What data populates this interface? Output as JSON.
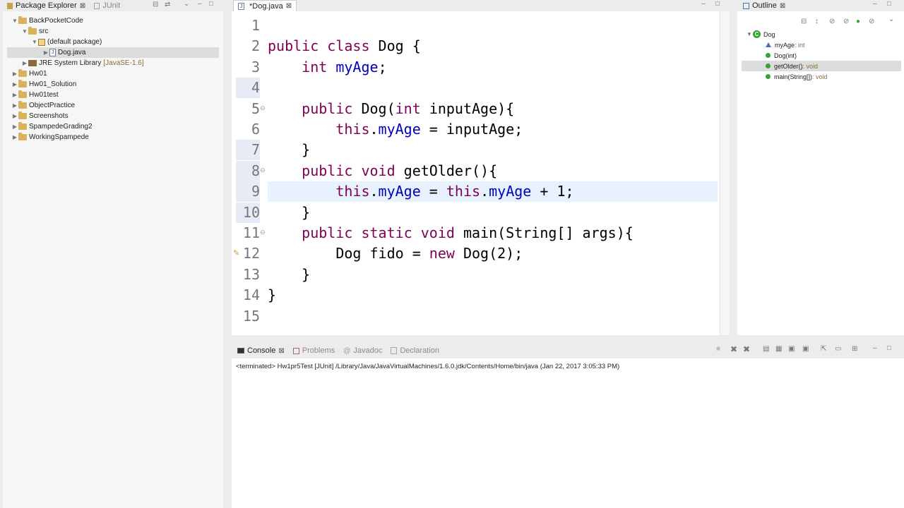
{
  "package_explorer": {
    "tabs": [
      {
        "label": "Package Explorer",
        "active": true
      },
      {
        "label": "JUnit",
        "active": false
      }
    ],
    "tree": [
      {
        "label": "BackPocketCode",
        "depth": 0,
        "expanded": true,
        "kind": "project"
      },
      {
        "label": "src",
        "depth": 1,
        "expanded": true,
        "kind": "folder"
      },
      {
        "label": "(default package)",
        "depth": 2,
        "expanded": true,
        "kind": "package"
      },
      {
        "label": "Dog.java",
        "depth": 3,
        "expanded": false,
        "kind": "file",
        "selected": true
      },
      {
        "label": "JRE System Library",
        "suffix": "[JavaSE-1.6]",
        "depth": 1,
        "expanded": false,
        "kind": "library"
      },
      {
        "label": "Hw01",
        "depth": 0,
        "expanded": false,
        "kind": "project"
      },
      {
        "label": "Hw01_Solution",
        "depth": 0,
        "expanded": false,
        "kind": "project"
      },
      {
        "label": "Hw01test",
        "depth": 0,
        "expanded": false,
        "kind": "project"
      },
      {
        "label": "ObjectPractice",
        "depth": 0,
        "expanded": false,
        "kind": "project"
      },
      {
        "label": "Screenshots",
        "depth": 0,
        "expanded": false,
        "kind": "project"
      },
      {
        "label": "SpampedeGrading2",
        "depth": 0,
        "expanded": false,
        "kind": "project"
      },
      {
        "label": "WorkingSpampede",
        "depth": 0,
        "expanded": false,
        "kind": "project"
      }
    ]
  },
  "editor": {
    "tab_label": "*Dog.java",
    "current_line": 9,
    "lines": [
      {
        "n": "1",
        "code": []
      },
      {
        "n": "2",
        "code": [
          {
            "t": "public class ",
            "k": "kw"
          },
          {
            "t": "Dog {",
            "k": ""
          }
        ]
      },
      {
        "n": "3",
        "code": [
          {
            "t": "    ",
            "k": ""
          },
          {
            "t": "int ",
            "k": "kw"
          },
          {
            "t": "myAge",
            "k": "fld"
          },
          {
            "t": ";",
            "k": ""
          }
        ]
      },
      {
        "n": "4",
        "code": []
      },
      {
        "n": "5",
        "code": [
          {
            "t": "    ",
            "k": ""
          },
          {
            "t": "public ",
            "k": "kw"
          },
          {
            "t": "Dog(",
            "k": ""
          },
          {
            "t": "int ",
            "k": "kw"
          },
          {
            "t": "inputAge){",
            "k": ""
          }
        ]
      },
      {
        "n": "6",
        "code": [
          {
            "t": "        ",
            "k": ""
          },
          {
            "t": "this",
            "k": "kw"
          },
          {
            "t": ".",
            "k": ""
          },
          {
            "t": "myAge",
            "k": "fld"
          },
          {
            "t": " = inputAge;",
            "k": ""
          }
        ]
      },
      {
        "n": "7",
        "code": [
          {
            "t": "    }",
            "k": ""
          }
        ]
      },
      {
        "n": "8",
        "code": [
          {
            "t": "    ",
            "k": ""
          },
          {
            "t": "public void ",
            "k": "kw"
          },
          {
            "t": "getOlder(){",
            "k": ""
          }
        ]
      },
      {
        "n": "9",
        "code": [
          {
            "t": "        ",
            "k": ""
          },
          {
            "t": "this",
            "k": "kw"
          },
          {
            "t": ".",
            "k": ""
          },
          {
            "t": "myAge",
            "k": "fld"
          },
          {
            "t": " = ",
            "k": ""
          },
          {
            "t": "this",
            "k": "kw"
          },
          {
            "t": ".",
            "k": ""
          },
          {
            "t": "myAge",
            "k": "fld"
          },
          {
            "t": " + 1;",
            "k": ""
          }
        ]
      },
      {
        "n": "10",
        "code": [
          {
            "t": "    }",
            "k": ""
          }
        ]
      },
      {
        "n": "11",
        "code": [
          {
            "t": "    ",
            "k": ""
          },
          {
            "t": "public static void ",
            "k": "kw"
          },
          {
            "t": "main(String[] args){",
            "k": ""
          }
        ]
      },
      {
        "n": "12",
        "code": [
          {
            "t": "        Dog fido = ",
            "k": ""
          },
          {
            "t": "new ",
            "k": "kw"
          },
          {
            "t": "Dog(2);",
            "k": ""
          }
        ]
      },
      {
        "n": "13",
        "code": [
          {
            "t": "    }",
            "k": ""
          }
        ]
      },
      {
        "n": "14",
        "code": [
          {
            "t": "}",
            "k": ""
          }
        ]
      },
      {
        "n": "15",
        "code": []
      }
    ]
  },
  "outline": {
    "tab_label": "Outline",
    "items": [
      {
        "label": "Dog",
        "extra": "",
        "kind": "class",
        "depth": 0
      },
      {
        "label": "myAge",
        "extra": " : int",
        "kind": "field",
        "depth": 1
      },
      {
        "label": "Dog(int)",
        "extra": "",
        "kind": "constructor",
        "depth": 1
      },
      {
        "label": "getOlder()",
        "extra": " : void",
        "kind": "method",
        "depth": 1,
        "selected": true
      },
      {
        "label": "main(String[])",
        "extra": " : void",
        "kind": "static-method",
        "depth": 1
      }
    ]
  },
  "console": {
    "tabs": [
      {
        "label": "Console",
        "active": true
      },
      {
        "label": "Problems",
        "active": false
      },
      {
        "label": "Javadoc",
        "active": false
      },
      {
        "label": "Declaration",
        "active": false
      }
    ],
    "status_text": "<terminated> Hw1pr5Test [JUnit] /Library/Java/JavaVirtualMachines/1.6.0.jdk/Contents/Home/bin/java (Jan 22, 2017 3:05:33 PM)"
  },
  "colors": {
    "keyword": "#7f0055",
    "field": "#0000c0",
    "current_line_bg": "#e8f2fe"
  }
}
